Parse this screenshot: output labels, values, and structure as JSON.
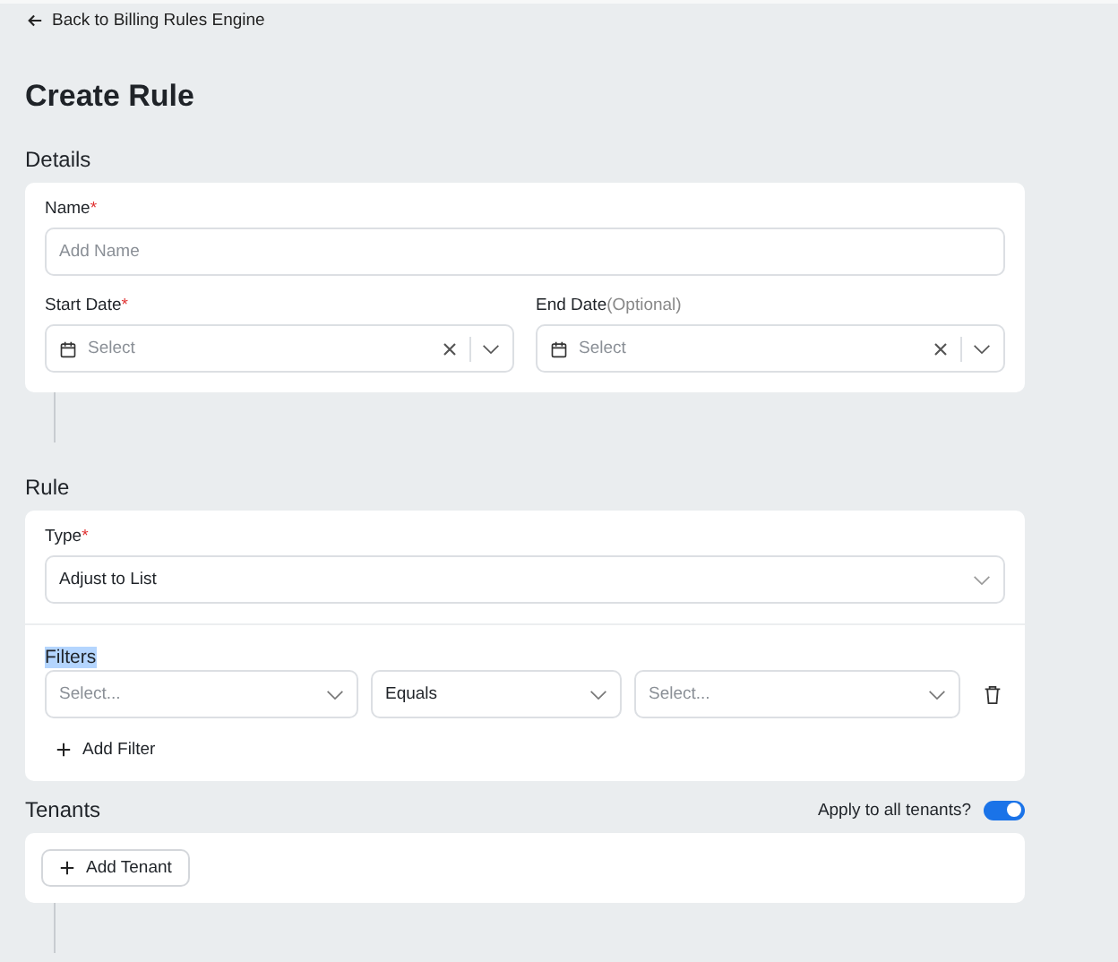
{
  "back_link": {
    "label": "Back to Billing Rules Engine"
  },
  "title": "Create Rule",
  "details": {
    "heading": "Details",
    "name_field": {
      "label": "Name",
      "required_mark": "*",
      "placeholder": "Add Name"
    },
    "start_date": {
      "label": "Start Date",
      "required_mark": "*",
      "placeholder": "Select"
    },
    "end_date": {
      "label": "End Date",
      "hint": "(Optional)",
      "placeholder": "Select"
    }
  },
  "rule": {
    "heading": "Rule",
    "type_field": {
      "label": "Type",
      "required_mark": "*",
      "value": "Adjust to List"
    },
    "filters": {
      "heading": "Filters",
      "highlighted": true,
      "selects": [
        {
          "text": "Select...",
          "is_placeholder": true
        },
        {
          "text": "Equals",
          "is_placeholder": false
        },
        {
          "text": "Select...",
          "is_placeholder": true
        }
      ],
      "add_button": "Add Filter"
    }
  },
  "tenants": {
    "heading": "Tenants",
    "toggle_label": "Apply to all tenants?",
    "toggle_on": true,
    "add_button": "Add Tenant"
  }
}
